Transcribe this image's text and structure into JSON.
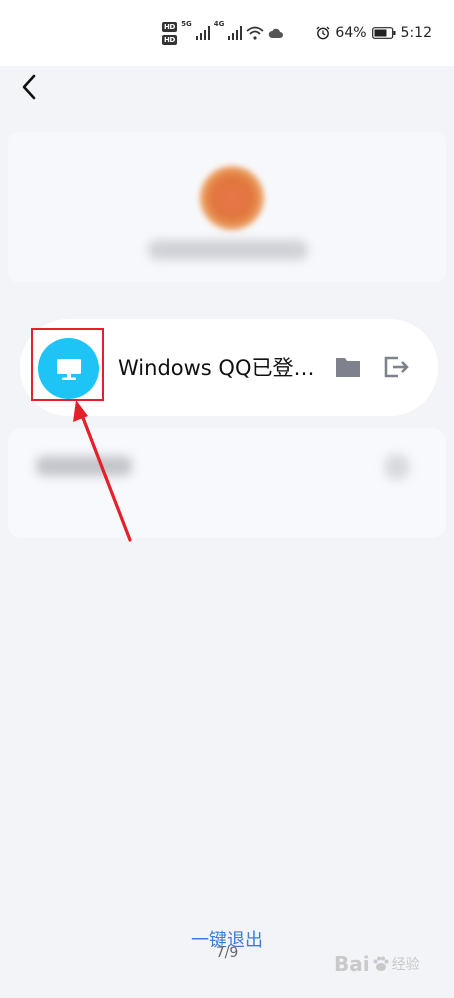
{
  "status_bar": {
    "hd1": "HD",
    "hd2": "HD",
    "network1": "5G",
    "network2": "4G",
    "battery": "64%",
    "time": "5:12"
  },
  "device": {
    "label": "Windows QQ已登…",
    "icon": "desktop-computer-icon",
    "icon_color": "#1ec4f6"
  },
  "annotation": {
    "box_color": "#e5202a",
    "arrow_color": "#e5202a"
  },
  "footer": {
    "logout_all": "一键退出",
    "page_indicator": "7/9"
  },
  "watermark": {
    "brand": "Bai",
    "sub": "经验"
  }
}
